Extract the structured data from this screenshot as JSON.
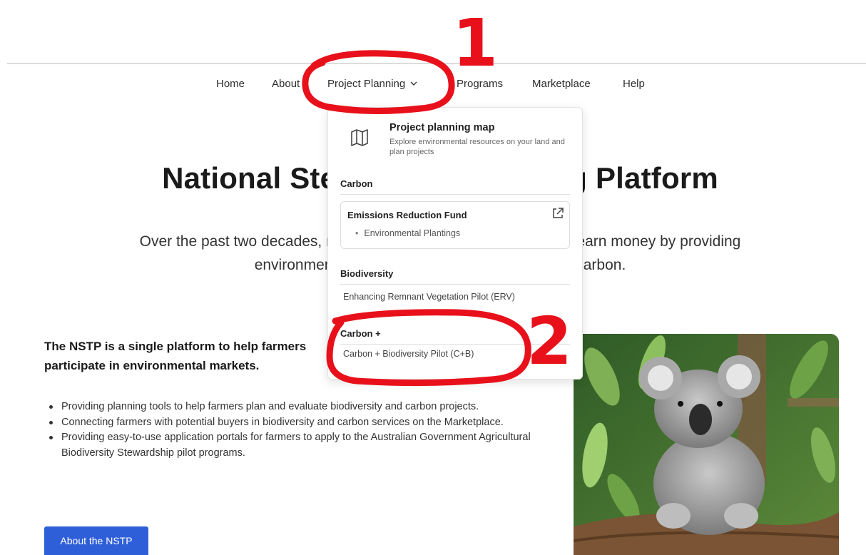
{
  "nav": {
    "items": [
      {
        "label": "Home"
      },
      {
        "label": "About"
      },
      {
        "label": "Project Planning"
      },
      {
        "label": "Programs"
      },
      {
        "label": "Marketplace"
      },
      {
        "label": "Help"
      }
    ]
  },
  "dropdown": {
    "map_title": "Project planning map",
    "map_description": "Explore environmental resources on your land and plan projects",
    "carbon_heading": "Carbon",
    "carbon_card": {
      "title": "Emissions Reduction Fund",
      "items": [
        "Environmental Plantings"
      ]
    },
    "biodiversity_heading": "Biodiversity",
    "biodiversity_link": "Enhancing Remnant Vegetation Pilot (ERV)",
    "carbon_plus_heading": "Carbon +",
    "carbon_plus_link": "Carbon + Biodiversity Pilot (C+B)"
  },
  "hero": {
    "title": "National Stewardship Trading Platform",
    "subtitle": "Over the past two decades, markets have emerged for farmers to earn money by providing environmental services such as biodiversity and carbon."
  },
  "intro": {
    "heading": "The NSTP is a single platform to help farmers participate in environmental markets.",
    "bullets": [
      "Providing planning tools to help farmers plan and evaluate biodiversity and carbon projects.",
      "Connecting farmers with potential buyers in biodiversity and carbon services on the Marketplace.",
      "Providing easy-to-use application portals for farmers to apply to the Australian Government Agricultural Biodiversity Stewardship pilot programs."
    ],
    "button_label": "About the NSTP"
  },
  "annotations": {
    "marker_1": "1",
    "marker_2": "2",
    "color": "#e8111b"
  },
  "colors": {
    "accent": "#2f5fd8"
  }
}
